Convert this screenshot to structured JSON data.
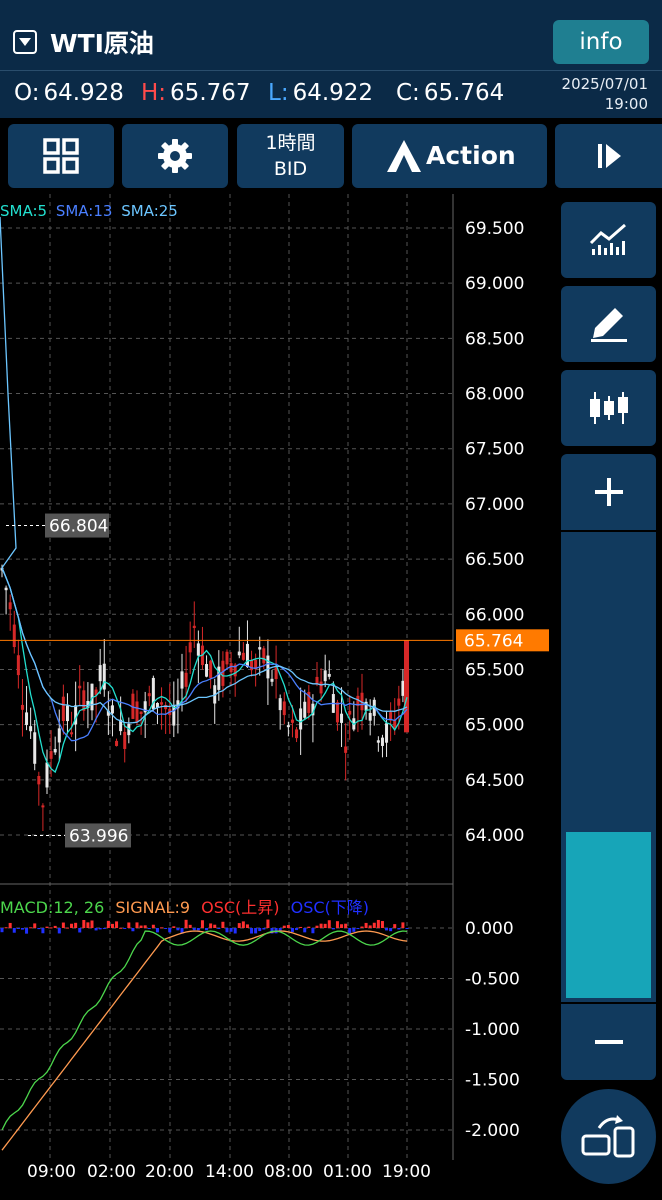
{
  "header": {
    "symbol": "WTI原油",
    "info_label": "info",
    "ohlc": {
      "o_key": "O:",
      "o_val": "64.928",
      "h_key": "H:",
      "h_val": "65.767",
      "l_key": "L:",
      "l_val": "64.922",
      "c_key": "C:",
      "c_val": "65.764"
    },
    "date": "2025/07/01",
    "time": "19:00"
  },
  "toolbar": {
    "grid_icon": "grid-icon",
    "settings_icon": "gear-icon",
    "timeframe": "1時間",
    "price_type": "BID",
    "action_label": "Action",
    "play_icon": "play-icon"
  },
  "indicators": {
    "sma5": "SMA:5",
    "sma13": "SMA:13",
    "sma25": "SMA:25",
    "macd": "MACD:12, 26",
    "signal": "SIGNAL:9",
    "osc_up": "OSC(上昇)",
    "osc_down": "OSC(下降)"
  },
  "price_axis": [
    "69.500",
    "69.000",
    "68.500",
    "68.000",
    "67.500",
    "67.000",
    "66.500",
    "66.000",
    "65.500",
    "65.000",
    "64.500",
    "64.000"
  ],
  "current_price": "65.764",
  "high_marker": "66.804",
  "low_marker": "63.996",
  "macd_axis": [
    "0.000",
    "-0.500",
    "-1.000",
    "-1.500",
    "-2.000"
  ],
  "time_axis": [
    "09:00",
    "02:00",
    "20:00",
    "14:00",
    "08:00",
    "01:00",
    "19:00"
  ],
  "sidebar": {
    "icons": [
      "chart-line-icon",
      "pencil-icon",
      "candlestick-icon",
      "plus-icon",
      "minus-icon",
      "rotate-screen-icon"
    ]
  },
  "colors": {
    "header_bg": "#0b2a47",
    "button_bg": "#113a5e",
    "info_bg": "#1f7f91",
    "current_price": "#ff7a00",
    "bull": "#e8e8e8",
    "bear": "#d62828",
    "sma5": "#22e0d0",
    "sma13": "#4a7fff",
    "sma25": "#6cc6ff",
    "macd": "#4cd64c",
    "signal": "#ff9a50",
    "osc_up": "#ff3030",
    "osc_down": "#2030ff",
    "zoom_fill": "#17a5b8"
  }
}
